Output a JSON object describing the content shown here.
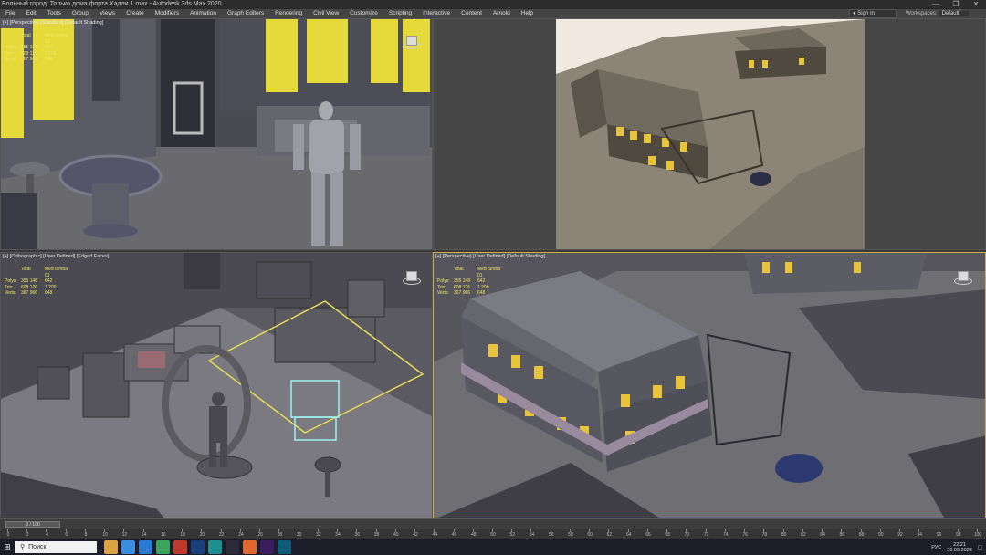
{
  "window": {
    "title": "Вольный город: Только дома форта Хадли 1.max - Autodesk 3ds Max 2020",
    "minimize": "—",
    "maximize": "❐",
    "close": "✕"
  },
  "menu": [
    "File",
    "Edit",
    "Tools",
    "Group",
    "Views",
    "Create",
    "Modifiers",
    "Animation",
    "Graph Editors",
    "Rendering",
    "Civil View",
    "Customize",
    "Scripting",
    "Interactive",
    "Content",
    "Arnold",
    "Help"
  ],
  "signin": {
    "label": "Sign In"
  },
  "workspace": {
    "label": "Workspaces:",
    "value": "Default"
  },
  "viewports": {
    "tl": {
      "label": "[+] [Perspective] [Standard] [Default Shading]"
    },
    "tr": {
      "label": ""
    },
    "bl": {
      "label": "[+] [Orthographic] [User Defined] [Edged Faces]"
    },
    "br": {
      "label": "[+] [Perspective] [User Defined] [Default Shading]"
    }
  },
  "stats_tl": {
    "h_total": "Total",
    "h_obj": "Med tumba 01",
    "polys_k": "Polys:",
    "polys_t": "355 148",
    "polys_o": "642",
    "tris_k": "Tris:",
    "tris_t": "608 126",
    "tris_o": "1 200",
    "verts_k": "Verts:",
    "verts_t": "367 966",
    "verts_o": "648"
  },
  "stats_bl": {
    "h_total": "Total",
    "h_obj": "Med tumba 01",
    "polys_k": "Polys:",
    "polys_t": "355 148",
    "polys_o": "642",
    "tris_k": "Tris:",
    "tris_t": "608 126",
    "tris_o": "1 200",
    "verts_k": "Verts:",
    "verts_t": "367 966",
    "verts_o": "648"
  },
  "stats_br": {
    "h_total": "Total",
    "h_obj": "Med tumba 01",
    "polys_k": "Polys:",
    "polys_t": "355 148",
    "polys_o": "642",
    "tris_k": "Tris:",
    "tris_t": "608 126",
    "tris_o": "1 200",
    "verts_k": "Verts:",
    "verts_t": "367 966",
    "verts_o": "648"
  },
  "timeline": {
    "frame": "0 / 100",
    "ticks": [
      "0",
      "2",
      "4",
      "6",
      "8",
      "10",
      "12",
      "14",
      "16",
      "18",
      "20",
      "22",
      "24",
      "26",
      "28",
      "30",
      "32",
      "34",
      "36",
      "38",
      "40",
      "42",
      "44",
      "46",
      "48",
      "50",
      "52",
      "54",
      "56",
      "58",
      "60",
      "62",
      "64",
      "66",
      "68",
      "70",
      "72",
      "74",
      "76",
      "78",
      "80",
      "82",
      "84",
      "86",
      "88",
      "90",
      "92",
      "94",
      "96",
      "98",
      "100"
    ]
  },
  "taskbar": {
    "search": "Поиск",
    "apps": [
      "Explorer",
      "Chrome",
      "Mail",
      "Maps",
      "Calendar",
      "Ps",
      "3ds Max",
      "Steam",
      "Firefox",
      "Pr",
      "3ds"
    ],
    "lang": "РУС",
    "time": "22:21",
    "date": "20.09.2023"
  }
}
